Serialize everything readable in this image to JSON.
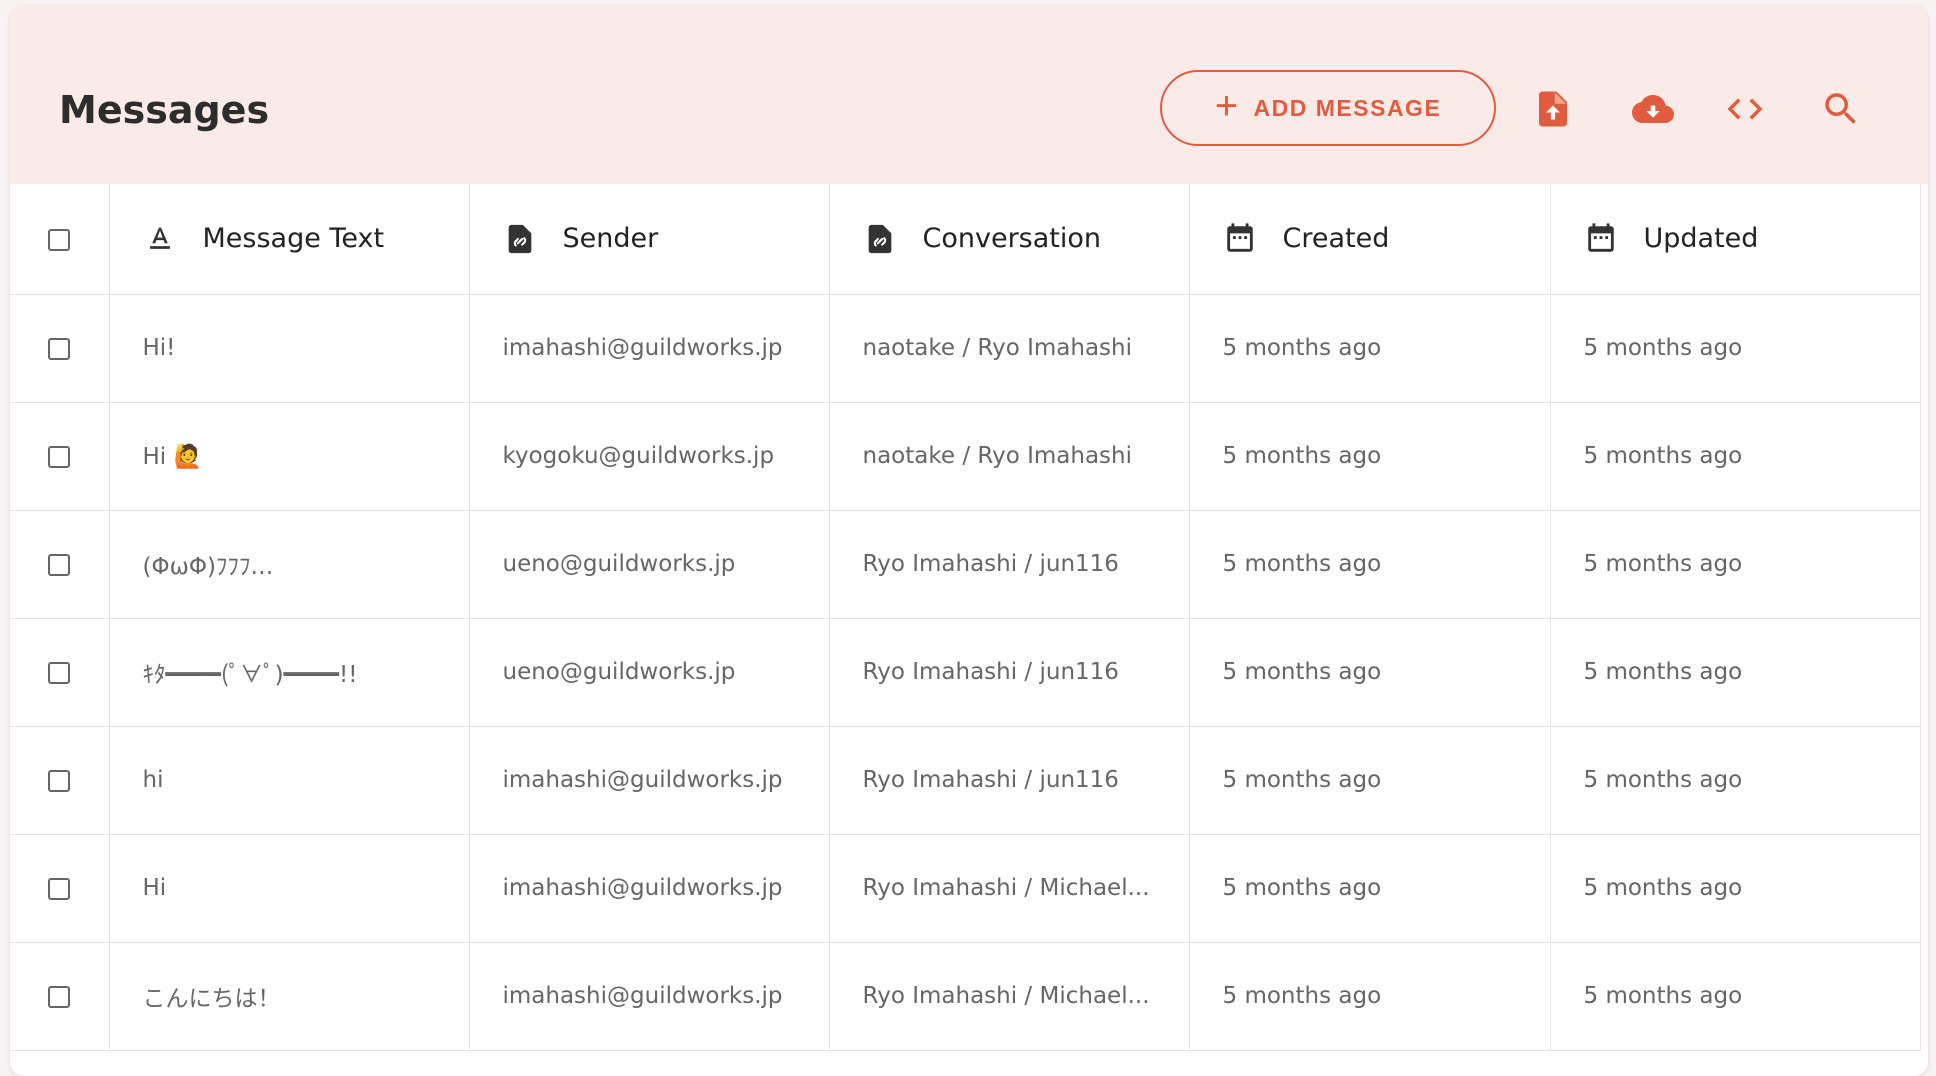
{
  "page": {
    "title": "Messages",
    "add_button_label": "ADD MESSAGE",
    "accent_color": "#e05c3e",
    "header_bg": "#fbebe8"
  },
  "toolbar_icons": [
    "import-file-icon",
    "download-cloud-icon",
    "code-icon",
    "search-icon"
  ],
  "columns": [
    {
      "label": "Message Text",
      "icon": "text-format-icon"
    },
    {
      "label": "Sender",
      "icon": "relation-link-icon"
    },
    {
      "label": "Conversation",
      "icon": "relation-link-icon"
    },
    {
      "label": "Created",
      "icon": "calendar-icon"
    },
    {
      "label": "Updated",
      "icon": "calendar-icon"
    }
  ],
  "rows": [
    {
      "text": "Hi!",
      "sender": "imahashi@guildworks.jp",
      "conversation": "naotake / Ryo Imahashi",
      "created": "5 months ago",
      "updated": "5 months ago"
    },
    {
      "text": "Hi 🙋",
      "sender": "kyogoku@guildworks.jp",
      "conversation": "naotake / Ryo Imahashi",
      "created": "5 months ago",
      "updated": "5 months ago"
    },
    {
      "text": "(ΦωΦ)ﾌﾌﾌ…",
      "sender": "ueno@guildworks.jp",
      "conversation": "Ryo Imahashi / jun116",
      "created": "5 months ago",
      "updated": "5 months ago"
    },
    {
      "text": "ｷﾀ━━━━(ﾟ∀ﾟ)━━━━!!",
      "sender": "ueno@guildworks.jp",
      "conversation": "Ryo Imahashi / jun116",
      "created": "5 months ago",
      "updated": "5 months ago"
    },
    {
      "text": "hi",
      "sender": "imahashi@guildworks.jp",
      "conversation": "Ryo Imahashi / jun116",
      "created": "5 months ago",
      "updated": "5 months ago"
    },
    {
      "text": "Hi",
      "sender": "imahashi@guildworks.jp",
      "conversation": "Ryo Imahashi / Michael...",
      "created": "5 months ago",
      "updated": "5 months ago"
    },
    {
      "text": "こんにちは！",
      "sender": "imahashi@guildworks.jp",
      "conversation": "Ryo Imahashi / Michael...",
      "created": "5 months ago",
      "updated": "5 months ago"
    }
  ]
}
